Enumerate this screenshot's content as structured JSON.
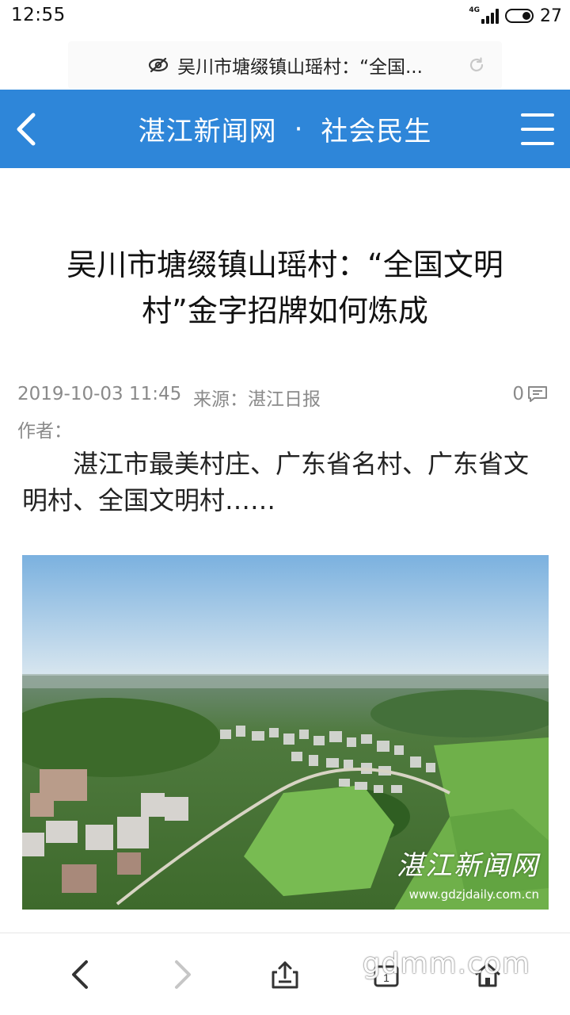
{
  "status_bar": {
    "time": "12:55",
    "network": "4G",
    "battery": "27"
  },
  "url_bar": {
    "text": "吴川市塘缀镇山瑶村：“全国..."
  },
  "nav": {
    "site_name": "湛江新闻网",
    "separator": "·",
    "section": "社会民生"
  },
  "article": {
    "title": "吴川市塘缀镇山瑶村：“全国文明村”金字招牌如何炼成",
    "date": "2019-10-03 11:45",
    "source": "来源：湛江日报",
    "author": "作者：",
    "comment_count": "0",
    "lead": "湛江市最美村庄、广东省名村、广东省文明村、全国文明村……",
    "image": {
      "description": "aerial village photo",
      "watermark": "湛江新闻网",
      "watermark_url": "www.gdzjdaily.com.cn"
    }
  },
  "site_watermark": "gdmm.com",
  "colors": {
    "nav_bg": "#2e86d9",
    "meta": "#8a8a8a"
  },
  "icons": [
    "eye-slash-icon",
    "refresh-icon",
    "back-chevron-icon",
    "hamburger-menu-icon",
    "comment-icon",
    "back-icon",
    "forward-icon",
    "share-icon",
    "tab-icon",
    "home-icon"
  ]
}
